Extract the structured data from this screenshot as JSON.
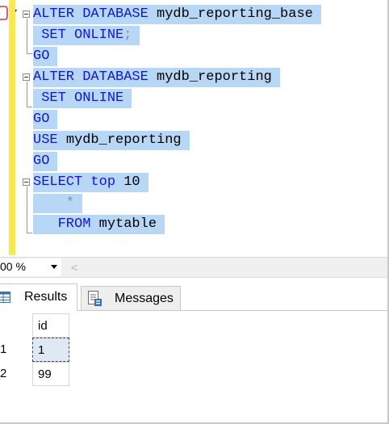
{
  "editor": {
    "code_lines": [
      {
        "parts": [
          {
            "t": "ALTER DATABASE ",
            "c": "kw"
          },
          {
            "t": "mydb_reporting_base",
            "c": "id"
          }
        ]
      },
      {
        "parts": [
          {
            "t": " SET ONLINE",
            "c": "kw"
          },
          {
            "t": ";",
            "c": "gr"
          }
        ]
      },
      {
        "parts": [
          {
            "t": "GO",
            "c": "kw"
          }
        ]
      },
      {
        "parts": [
          {
            "t": "ALTER DATABASE ",
            "c": "kw"
          },
          {
            "t": "mydb_reporting",
            "c": "id"
          }
        ]
      },
      {
        "parts": [
          {
            "t": " SET ONLINE",
            "c": "kw"
          }
        ]
      },
      {
        "parts": [
          {
            "t": "GO",
            "c": "kw"
          }
        ]
      },
      {
        "parts": [
          {
            "t": "USE ",
            "c": "kw"
          },
          {
            "t": "mydb_reporting",
            "c": "id"
          }
        ]
      },
      {
        "parts": [
          {
            "t": "GO",
            "c": "kw"
          }
        ]
      },
      {
        "parts": [
          {
            "t": "SELECT ",
            "c": "kw"
          },
          {
            "t": "top ",
            "c": "kw"
          },
          {
            "t": "10",
            "c": "id"
          }
        ]
      },
      {
        "parts": [
          {
            "t": "    *",
            "c": "gr"
          }
        ]
      },
      {
        "parts": [
          {
            "t": "   FROM ",
            "c": "kw"
          },
          {
            "t": "mytable",
            "c": "id"
          }
        ]
      }
    ]
  },
  "status_bar": {
    "zoom": "00 %",
    "scroll_left": "<"
  },
  "tabs": [
    {
      "label": "Results",
      "icon": "grid-icon"
    },
    {
      "label": "Messages",
      "icon": "messages-icon"
    }
  ],
  "results_grid": {
    "columns": [
      "id"
    ],
    "row_numbers": [
      "1",
      "2"
    ],
    "rows": [
      [
        "1"
      ],
      [
        "99"
      ]
    ]
  },
  "colors": {
    "selection": "#b7d7f7",
    "keyword": "#1414d6",
    "change_bar": "#f9e94f"
  }
}
